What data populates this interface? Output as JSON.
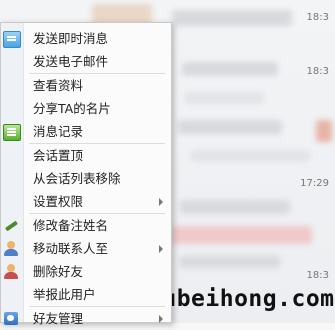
{
  "background": {
    "times": [
      "18:3",
      "18:3",
      "17:29",
      "18:3"
    ],
    "badge": "",
    "watermark": "hubeihong.com"
  },
  "menu": {
    "items": [
      {
        "label": "发送即时消息",
        "icon": "chat-bubble-icon",
        "submenu": false
      },
      {
        "label": "发送电子邮件",
        "icon": "",
        "submenu": false
      },
      {
        "label": "查看资料",
        "icon": "",
        "submenu": false
      },
      {
        "label": "分享TA的名片",
        "icon": "",
        "submenu": false
      },
      {
        "label": "消息记录",
        "icon": "message-log-icon",
        "submenu": false
      },
      {
        "label": "会话置顶",
        "icon": "",
        "submenu": false
      },
      {
        "label": "从会话列表移除",
        "icon": "",
        "submenu": false
      },
      {
        "label": "设置权限",
        "icon": "",
        "submenu": true
      },
      {
        "label": "修改备注姓名",
        "icon": "pen-icon",
        "submenu": false
      },
      {
        "label": "移动联系人至",
        "icon": "user-move-icon",
        "submenu": true
      },
      {
        "label": "删除好友",
        "icon": "user-delete-icon",
        "submenu": false
      },
      {
        "label": "举报此用户",
        "icon": "",
        "submenu": false
      },
      {
        "label": "好友管理",
        "icon": "contact-manage-icon",
        "submenu": true
      }
    ]
  }
}
